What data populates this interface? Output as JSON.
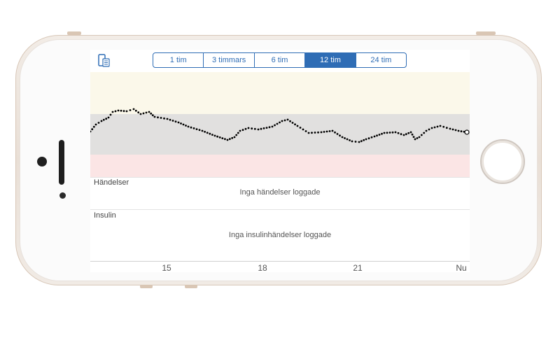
{
  "toolbar": {
    "device_icon": "phone-device-icon",
    "ranges": [
      "1 tim",
      "3 timmars",
      "6 tim",
      "12 tim",
      "24 tim"
    ],
    "selected_index": 3,
    "accent": "#2f6db5"
  },
  "graph": {
    "zones": {
      "high": "#fbf8ea",
      "target": "#e1e0df",
      "low": "#fbe5e5"
    },
    "series_color": "#000000"
  },
  "events": {
    "label": "Händelser",
    "message": "Inga händelser loggade"
  },
  "insulin": {
    "label": "Insulin",
    "message": "Inga insulinhändelser loggade"
  },
  "axis": {
    "ticks": [
      "15",
      "18",
      "21",
      "Nu"
    ]
  }
}
